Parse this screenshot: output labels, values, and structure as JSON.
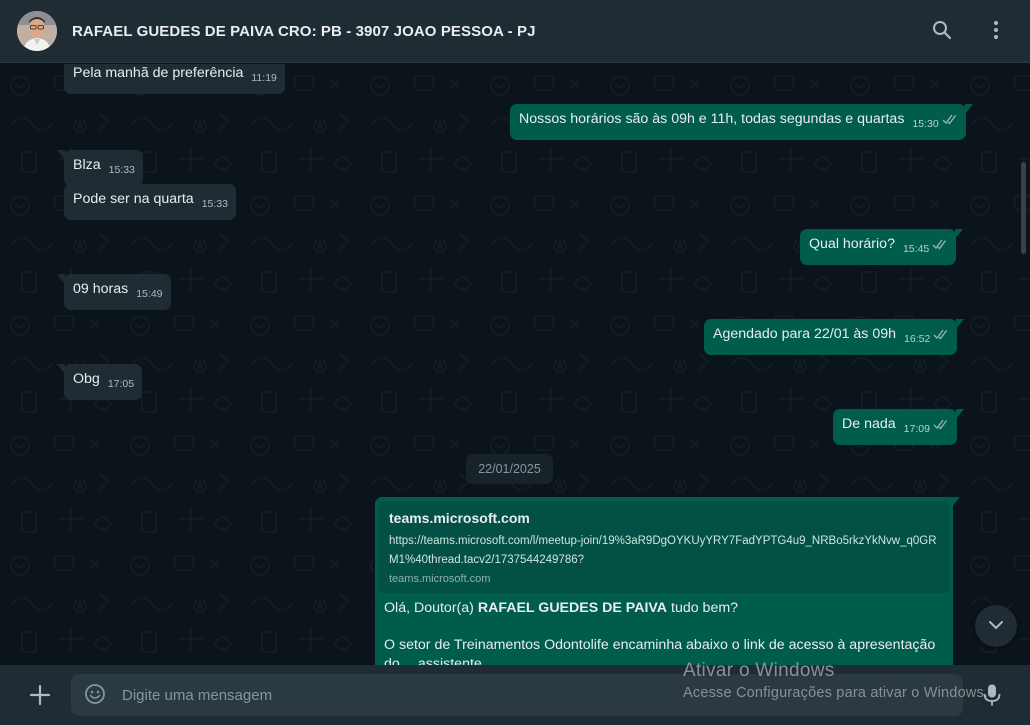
{
  "header": {
    "contact_name": "RAFAEL GUEDES DE PAIVA CRO: PB - 3907 JOAO PESSOA - PJ",
    "icons": [
      "search-icon",
      "menu-icon"
    ]
  },
  "messages": [
    {
      "id": "m1",
      "direction": "in",
      "text": "Pela manhã de preferência",
      "time": "11:19"
    },
    {
      "id": "m2",
      "direction": "out",
      "text": "Nossos horários são às 09h e 11h, todas segundas e quartas",
      "time": "15:30",
      "status": "read"
    },
    {
      "id": "m3",
      "direction": "in",
      "text": "Blza",
      "time": "15:33"
    },
    {
      "id": "m4",
      "direction": "in",
      "text": "Pode ser na quarta",
      "time": "15:33"
    },
    {
      "id": "m5",
      "direction": "out",
      "text": "Qual horário?",
      "time": "15:45",
      "status": "read"
    },
    {
      "id": "m6",
      "direction": "in",
      "text": "09 horas",
      "time": "15:49"
    },
    {
      "id": "m7",
      "direction": "out",
      "text": "Agendado para 22/01 às 09h",
      "time": "16:52",
      "status": "read"
    },
    {
      "id": "m8",
      "direction": "in",
      "text": "Obg",
      "time": "17:05"
    },
    {
      "id": "m9",
      "direction": "out",
      "text": "De nada",
      "time": "17:09",
      "status": "read"
    }
  ],
  "date_separator": "22/01/2025",
  "link_message": {
    "preview_title": "teams.microsoft.com",
    "preview_url": "https://teams.microsoft.com/l/meetup-join/19%3aR9DgOYKUyYRY7FadYPTG4u9_NRBo5rkzYkNvw_q0GRM1%40thread.tacv2/1737544249786?",
    "preview_domain": "teams.microsoft.com",
    "greeting_prefix": "Olá, Doutor(a)",
    "greeting_name": "RAFAEL GUEDES DE PAIVA",
    "greeting_suffix": "tudo bem?",
    "body_line": "O setor de Treinamentos Odontolife encaminha abaixo o link de acesso à apresentação",
    "body_cut": "do… assistente"
  },
  "composer": {
    "placeholder": "Digite uma mensagem",
    "value": ""
  },
  "watermark": {
    "line1": "Ativar o Windows",
    "line2": "Acesse Configurações para ativar o Windows."
  },
  "colors": {
    "header_bg": "#202c33",
    "chat_bg": "#0b141a",
    "incoming_bubble": "#202c33",
    "outgoing_bubble": "#005c4b",
    "read_ticks": "#8fb3aa"
  }
}
